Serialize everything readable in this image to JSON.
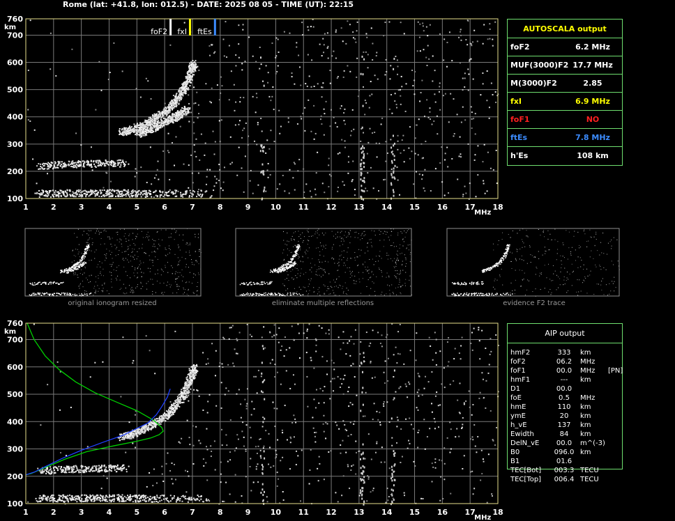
{
  "header": {
    "title": "Rome (lat: +41.8, lon: 012.5) - DATE: 2025 08 05 - TIME (UT): 22:15"
  },
  "autoscala": {
    "title": "AUTOSCALA output",
    "rows": [
      {
        "label": "foF2",
        "value": "6.2 MHz",
        "color": "#ffffff"
      },
      {
        "label": "MUF(3000)F2",
        "value": "17.7 MHz",
        "color": "#ffffff"
      },
      {
        "label": "M(3000)F2",
        "value": "2.85",
        "color": "#ffffff"
      },
      {
        "label": "fxI",
        "value": "6.9 MHz",
        "color": "#ffff00"
      },
      {
        "label": "foF1",
        "value": "NO",
        "color": "#ff2020"
      },
      {
        "label": "ftEs",
        "value": "7.8 MHz",
        "color": "#3c8cff"
      },
      {
        "label": "h'Es",
        "value": "108    km",
        "color": "#ffffff"
      }
    ]
  },
  "aip": {
    "title": "AIP output",
    "rows": [
      {
        "k": "hmF2",
        "v": "333",
        "u": "km",
        "x": ""
      },
      {
        "k": "foF2",
        "v": "06.2",
        "u": "MHz",
        "x": ""
      },
      {
        "k": "foF1",
        "v": "00.0",
        "u": "MHz",
        "x": "[PN]"
      },
      {
        "k": "hmF1",
        "v": "---",
        "u": "km",
        "x": ""
      },
      {
        "k": "D1",
        "v": "00.0",
        "u": "",
        "x": ""
      },
      {
        "k": "foE",
        "v": "0.5",
        "u": "MHz",
        "x": ""
      },
      {
        "k": "hmE",
        "v": "110",
        "u": "km",
        "x": ""
      },
      {
        "k": "ymE",
        "v": "20",
        "u": "km",
        "x": ""
      },
      {
        "k": "h_vE",
        "v": "137",
        "u": "km",
        "x": ""
      },
      {
        "k": "Ewidth",
        "v": "84",
        "u": "km",
        "x": ""
      },
      {
        "k": "DelN_vE",
        "v": "00.0",
        "u": "m^(-3)",
        "x": ""
      },
      {
        "k": "B0",
        "v": "096.0",
        "u": "km",
        "x": ""
      },
      {
        "k": "B1",
        "v": "01.6",
        "u": "",
        "x": ""
      },
      {
        "k": "TEC[Bot]",
        "v": "003.3",
        "u": "TECU",
        "x": ""
      },
      {
        "k": "TEC[Top]",
        "v": "006.4",
        "u": "TECU",
        "x": ""
      }
    ]
  },
  "captions": {
    "thumb1": "original ionogram resized",
    "thumb2": "eliminate multiple reflections",
    "thumb3": "evidence F2 trace"
  },
  "chart_data": [
    {
      "type": "scatter",
      "name": "ionogram-top",
      "xlim": [
        1,
        18
      ],
      "ylim": [
        100,
        760
      ],
      "x_ticks": [
        1,
        2,
        3,
        4,
        5,
        6,
        7,
        8,
        9,
        10,
        11,
        12,
        13,
        14,
        15,
        16,
        17,
        18
      ],
      "y_ticks": [
        100,
        200,
        300,
        400,
        500,
        600,
        700,
        760
      ],
      "x_unit": "MHz",
      "y_unit": "km",
      "grid": true,
      "markers": [
        {
          "label": "foF2",
          "x": 6.2,
          "color": "#ffffff"
        },
        {
          "label": "fxI",
          "x": 6.9,
          "color": "#ffff00"
        },
        {
          "label": "ftEs",
          "x": 7.8,
          "color": "#3c8cff"
        }
      ],
      "traces": [
        {
          "name": "F2 o-trace",
          "points": [
            [
              4.4,
              345
            ],
            [
              4.8,
              355
            ],
            [
              5.2,
              372
            ],
            [
              5.6,
              395
            ],
            [
              6.0,
              420
            ],
            [
              6.3,
              450
            ],
            [
              6.6,
              490
            ],
            [
              6.8,
              530
            ],
            [
              6.95,
              575
            ],
            [
              7.05,
              600
            ]
          ]
        },
        {
          "name": "F2 x-trace",
          "points": [
            [
              5.0,
              340
            ],
            [
              5.4,
              355
            ],
            [
              5.8,
              372
            ],
            [
              6.2,
              392
            ],
            [
              6.5,
              410
            ],
            [
              6.8,
              430
            ]
          ]
        },
        {
          "name": "Es trace",
          "points": [
            [
              1.4,
              120
            ],
            [
              2.5,
              122
            ],
            [
              3.5,
              122
            ],
            [
              4.5,
              122
            ],
            [
              5.5,
              120
            ],
            [
              7.5,
              121
            ]
          ]
        },
        {
          "name": "2nd-hop Es",
          "points": [
            [
              1.5,
              222
            ],
            [
              2.5,
              228
            ],
            [
              3.5,
              230
            ],
            [
              4.6,
              232
            ]
          ]
        }
      ]
    },
    {
      "type": "line",
      "name": "ionogram-bottom",
      "xlim": [
        1,
        18
      ],
      "ylim": [
        100,
        760
      ],
      "x_ticks": [
        1,
        2,
        3,
        4,
        5,
        6,
        7,
        8,
        9,
        10,
        11,
        12,
        13,
        14,
        15,
        16,
        17,
        18
      ],
      "y_ticks": [
        100,
        200,
        300,
        400,
        500,
        600,
        700,
        760
      ],
      "x_unit": "MHz",
      "y_unit": "km",
      "grid": true,
      "series": [
        {
          "color": "#00d000",
          "points": [
            [
              1.05,
              760
            ],
            [
              1.3,
              700
            ],
            [
              1.7,
              640
            ],
            [
              2.2,
              590
            ],
            [
              2.8,
              545
            ],
            [
              3.5,
              505
            ],
            [
              4.3,
              470
            ],
            [
              5.0,
              440
            ],
            [
              5.6,
              405
            ],
            [
              5.9,
              378
            ],
            [
              5.95,
              365
            ],
            [
              5.8,
              352
            ],
            [
              5.5,
              340
            ],
            [
              5.0,
              328
            ],
            [
              4.2,
              312
            ],
            [
              3.2,
              290
            ],
            [
              2.4,
              262
            ],
            [
              1.7,
              232
            ],
            [
              1.2,
              210
            ],
            [
              1.0,
              205
            ]
          ]
        },
        {
          "color": "#2040ff",
          "points": [
            [
              1.0,
              205
            ],
            [
              1.3,
              215
            ],
            [
              1.7,
              235
            ],
            [
              2.3,
              265
            ],
            [
              3.0,
              295
            ],
            [
              3.8,
              325
            ],
            [
              4.5,
              350
            ],
            [
              5.0,
              375
            ],
            [
              5.4,
              395
            ],
            [
              5.7,
              425
            ],
            [
              5.9,
              455
            ],
            [
              6.1,
              490
            ],
            [
              6.2,
              520
            ]
          ]
        }
      ],
      "traces": [
        {
          "name": "F2 o-trace",
          "points": [
            [
              4.4,
              345
            ],
            [
              4.8,
              355
            ],
            [
              5.2,
              372
            ],
            [
              5.6,
              395
            ],
            [
              6.0,
              420
            ],
            [
              6.3,
              450
            ],
            [
              6.6,
              490
            ],
            [
              6.8,
              530
            ],
            [
              6.95,
              575
            ],
            [
              7.05,
              600
            ]
          ]
        },
        {
          "name": "Es trace",
          "points": [
            [
              1.4,
              120
            ],
            [
              2.5,
              122
            ],
            [
              3.5,
              122
            ],
            [
              4.5,
              122
            ],
            [
              5.5,
              120
            ],
            [
              7.5,
              121
            ]
          ]
        },
        {
          "name": "2nd-hop Es",
          "points": [
            [
              1.5,
              222
            ],
            [
              2.5,
              228
            ],
            [
              3.5,
              230
            ],
            [
              4.6,
              232
            ]
          ]
        }
      ]
    }
  ]
}
